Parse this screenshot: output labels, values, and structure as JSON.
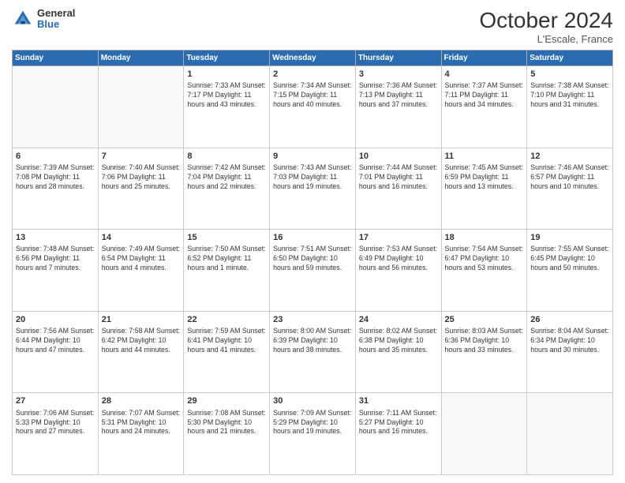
{
  "logo": {
    "general": "General",
    "blue": "Blue"
  },
  "header": {
    "month": "October 2024",
    "location": "L'Escale, France"
  },
  "weekdays": [
    "Sunday",
    "Monday",
    "Tuesday",
    "Wednesday",
    "Thursday",
    "Friday",
    "Saturday"
  ],
  "weeks": [
    [
      {
        "day": "",
        "info": ""
      },
      {
        "day": "",
        "info": ""
      },
      {
        "day": "1",
        "info": "Sunrise: 7:33 AM\nSunset: 7:17 PM\nDaylight: 11 hours and 43 minutes."
      },
      {
        "day": "2",
        "info": "Sunrise: 7:34 AM\nSunset: 7:15 PM\nDaylight: 11 hours and 40 minutes."
      },
      {
        "day": "3",
        "info": "Sunrise: 7:36 AM\nSunset: 7:13 PM\nDaylight: 11 hours and 37 minutes."
      },
      {
        "day": "4",
        "info": "Sunrise: 7:37 AM\nSunset: 7:11 PM\nDaylight: 11 hours and 34 minutes."
      },
      {
        "day": "5",
        "info": "Sunrise: 7:38 AM\nSunset: 7:10 PM\nDaylight: 11 hours and 31 minutes."
      }
    ],
    [
      {
        "day": "6",
        "info": "Sunrise: 7:39 AM\nSunset: 7:08 PM\nDaylight: 11 hours and 28 minutes."
      },
      {
        "day": "7",
        "info": "Sunrise: 7:40 AM\nSunset: 7:06 PM\nDaylight: 11 hours and 25 minutes."
      },
      {
        "day": "8",
        "info": "Sunrise: 7:42 AM\nSunset: 7:04 PM\nDaylight: 11 hours and 22 minutes."
      },
      {
        "day": "9",
        "info": "Sunrise: 7:43 AM\nSunset: 7:03 PM\nDaylight: 11 hours and 19 minutes."
      },
      {
        "day": "10",
        "info": "Sunrise: 7:44 AM\nSunset: 7:01 PM\nDaylight: 11 hours and 16 minutes."
      },
      {
        "day": "11",
        "info": "Sunrise: 7:45 AM\nSunset: 6:59 PM\nDaylight: 11 hours and 13 minutes."
      },
      {
        "day": "12",
        "info": "Sunrise: 7:46 AM\nSunset: 6:57 PM\nDaylight: 11 hours and 10 minutes."
      }
    ],
    [
      {
        "day": "13",
        "info": "Sunrise: 7:48 AM\nSunset: 6:56 PM\nDaylight: 11 hours and 7 minutes."
      },
      {
        "day": "14",
        "info": "Sunrise: 7:49 AM\nSunset: 6:54 PM\nDaylight: 11 hours and 4 minutes."
      },
      {
        "day": "15",
        "info": "Sunrise: 7:50 AM\nSunset: 6:52 PM\nDaylight: 11 hours and 1 minute."
      },
      {
        "day": "16",
        "info": "Sunrise: 7:51 AM\nSunset: 6:50 PM\nDaylight: 10 hours and 59 minutes."
      },
      {
        "day": "17",
        "info": "Sunrise: 7:53 AM\nSunset: 6:49 PM\nDaylight: 10 hours and 56 minutes."
      },
      {
        "day": "18",
        "info": "Sunrise: 7:54 AM\nSunset: 6:47 PM\nDaylight: 10 hours and 53 minutes."
      },
      {
        "day": "19",
        "info": "Sunrise: 7:55 AM\nSunset: 6:45 PM\nDaylight: 10 hours and 50 minutes."
      }
    ],
    [
      {
        "day": "20",
        "info": "Sunrise: 7:56 AM\nSunset: 6:44 PM\nDaylight: 10 hours and 47 minutes."
      },
      {
        "day": "21",
        "info": "Sunrise: 7:58 AM\nSunset: 6:42 PM\nDaylight: 10 hours and 44 minutes."
      },
      {
        "day": "22",
        "info": "Sunrise: 7:59 AM\nSunset: 6:41 PM\nDaylight: 10 hours and 41 minutes."
      },
      {
        "day": "23",
        "info": "Sunrise: 8:00 AM\nSunset: 6:39 PM\nDaylight: 10 hours and 38 minutes."
      },
      {
        "day": "24",
        "info": "Sunrise: 8:02 AM\nSunset: 6:38 PM\nDaylight: 10 hours and 35 minutes."
      },
      {
        "day": "25",
        "info": "Sunrise: 8:03 AM\nSunset: 6:36 PM\nDaylight: 10 hours and 33 minutes."
      },
      {
        "day": "26",
        "info": "Sunrise: 8:04 AM\nSunset: 6:34 PM\nDaylight: 10 hours and 30 minutes."
      }
    ],
    [
      {
        "day": "27",
        "info": "Sunrise: 7:06 AM\nSunset: 5:33 PM\nDaylight: 10 hours and 27 minutes."
      },
      {
        "day": "28",
        "info": "Sunrise: 7:07 AM\nSunset: 5:31 PM\nDaylight: 10 hours and 24 minutes."
      },
      {
        "day": "29",
        "info": "Sunrise: 7:08 AM\nSunset: 5:30 PM\nDaylight: 10 hours and 21 minutes."
      },
      {
        "day": "30",
        "info": "Sunrise: 7:09 AM\nSunset: 5:29 PM\nDaylight: 10 hours and 19 minutes."
      },
      {
        "day": "31",
        "info": "Sunrise: 7:11 AM\nSunset: 5:27 PM\nDaylight: 10 hours and 16 minutes."
      },
      {
        "day": "",
        "info": ""
      },
      {
        "day": "",
        "info": ""
      }
    ]
  ]
}
